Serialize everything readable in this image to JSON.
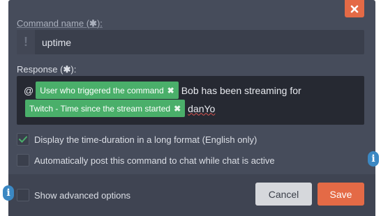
{
  "dialog": {
    "close_label": "×",
    "command_name": {
      "label": "Command name (",
      "required_mark": "✱",
      "label_suffix": "):",
      "prefix_icon": "exclamation-icon",
      "value": "uptime"
    },
    "response": {
      "label": "Response (",
      "required_mark": "✱",
      "label_suffix": "):",
      "line1_prefix": "@",
      "chip1": "User who triggered the command",
      "line1_text": "Bob has been streaming for",
      "chip2": "Twitch - Time since the stream started",
      "line2_text": "danYo"
    },
    "options": [
      {
        "label": "Display the time-duration in a long format (English only)",
        "checked": true
      },
      {
        "label": "Automatically post this command to chat while chat is active",
        "checked": false
      },
      {
        "label": "Show advanced options",
        "checked": false
      }
    ],
    "info_badge": "i",
    "buttons": {
      "cancel": "Cancel",
      "save": "Save"
    },
    "colors": {
      "accent": "#e46a46",
      "chip": "#4aaf6a",
      "info": "#3b88c3",
      "panel": "#464c5b"
    }
  }
}
